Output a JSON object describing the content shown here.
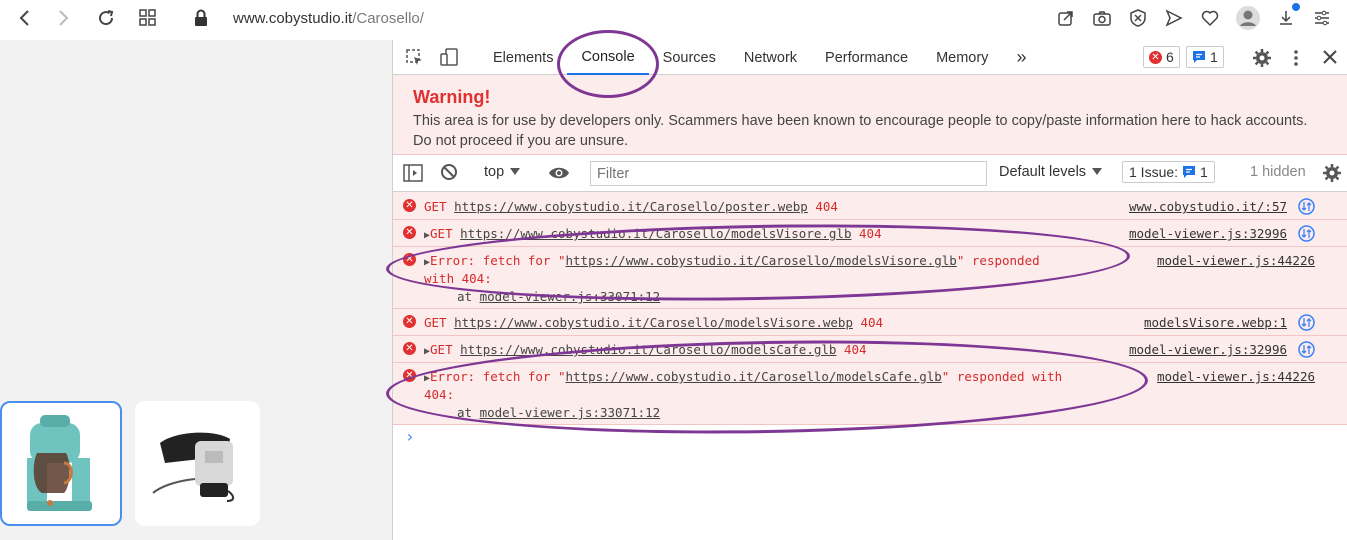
{
  "browser": {
    "url_host": "www.cobystudio.it",
    "url_path": "/Carosello/"
  },
  "devtools": {
    "tabs": [
      "Elements",
      "Console",
      "Sources",
      "Network",
      "Performance",
      "Memory"
    ],
    "more_tabs": "»",
    "error_count": "6",
    "message_count": "1",
    "warning_title": "Warning!",
    "warning_text": "This area is for use by developers only. Scammers have been known to encourage people to copy/paste information here to hack accounts. Do not proceed if you are unsure.",
    "context": "top",
    "filter_placeholder": "Filter",
    "levels": "Default levels",
    "issues_label": "1 Issue:",
    "issues_count": "1",
    "hidden": "1 hidden"
  },
  "console": {
    "row1": {
      "method": "GET",
      "url": "https://www.cobystudio.it/Carosello/poster.webp",
      "status": "404",
      "source": "www.cobystudio.it/:57"
    },
    "row2": {
      "method": "GET",
      "url": "https://www.cobystudio.it/Carosello/modelsVisore.glb",
      "status": "404",
      "source": "model-viewer.js:32996"
    },
    "row3": {
      "pre": "Error: fetch for \"",
      "url": "https://www.cobystudio.it/Carosello/modelsVisore.glb",
      "post": "\" responded",
      "line2": "with 404:",
      "at_pre": "at ",
      "at_link": "model-viewer.js:33071:12",
      "source": "model-viewer.js:44226"
    },
    "row4": {
      "method": "GET",
      "url": "https://www.cobystudio.it/Carosello/modelsVisore.webp",
      "status": "404",
      "source": "modelsVisore.webp:1"
    },
    "row5": {
      "method": "GET",
      "url": "https://www.cobystudio.it/Carosello/modelsCafe.glb",
      "status": "404",
      "source": "model-viewer.js:32996"
    },
    "row6": {
      "pre": "Error: fetch for \"",
      "url": "https://www.cobystudio.it/Carosello/modelsCafe.glb",
      "post": "\" responded with",
      "line2": "404:",
      "at_pre": "at ",
      "at_link": "model-viewer.js:33071:12",
      "source": "model-viewer.js:44226"
    },
    "prompt": "›"
  },
  "icons": {
    "colors": {
      "error": "#e03030",
      "accent": "#1a73e8",
      "annotation": "#7e3794",
      "thumb_border": "#4a8ef0"
    }
  }
}
